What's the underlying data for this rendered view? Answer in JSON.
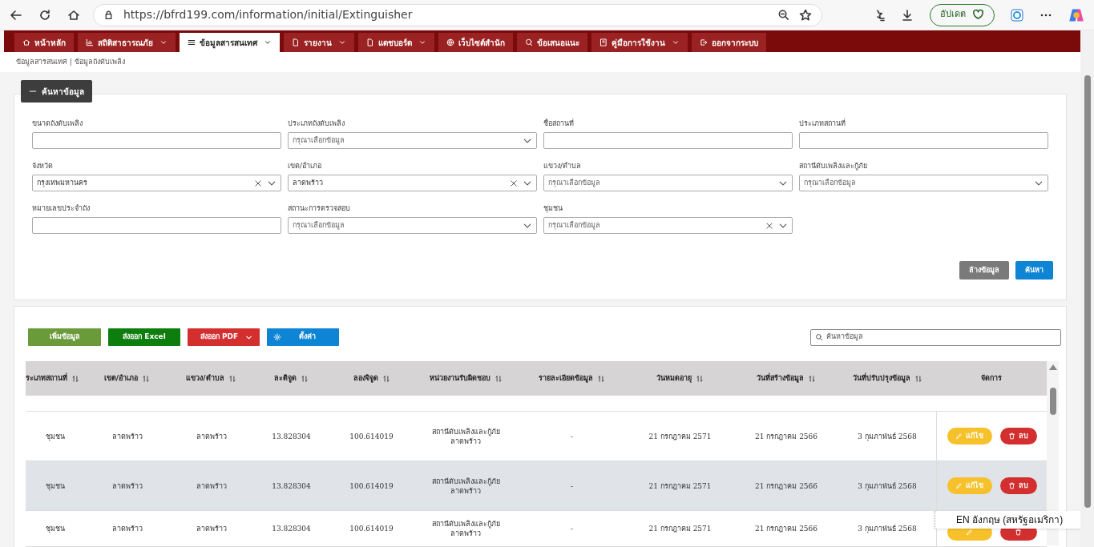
{
  "browser": {
    "url": "https://bfrd199.com/information/initial/Extinguisher",
    "update_button": "อัปเดต"
  },
  "nav": [
    {
      "label": "หน้าหลัก",
      "dropdown": false,
      "selected": false
    },
    {
      "label": "สถิติสาธารณภัย",
      "dropdown": true,
      "selected": false
    },
    {
      "label": "ข้อมูลสารสนเทศ",
      "dropdown": true,
      "selected": true
    },
    {
      "label": "รายงาน",
      "dropdown": true,
      "selected": false
    },
    {
      "label": "แดชบอร์ด",
      "dropdown": true,
      "selected": false
    },
    {
      "label": "เว็บไซต์สำนัก",
      "dropdown": false,
      "selected": false
    },
    {
      "label": "ข้อเสนอแนะ",
      "dropdown": false,
      "selected": false
    },
    {
      "label": "คู่มือการใช้งาน",
      "dropdown": true,
      "selected": false
    },
    {
      "label": "ออกจากระบบ",
      "dropdown": false,
      "selected": false
    }
  ],
  "breadcrumb": "ข้อมูลสารสนเทศ | ข้อมูลถังดับเพลิง",
  "search_panel": {
    "toggle": "ค้นหาข้อมูล",
    "expanded": true,
    "fields": [
      {
        "label": "ขนาดถังดับเพลิง",
        "kind": "text"
      },
      {
        "label": "ประเภทถังดับเพลิง",
        "kind": "select",
        "placeholder": "กรุณาเลือกข้อมูล",
        "clearable": false
      },
      {
        "label": "ชื่อสถานที่",
        "kind": "text"
      },
      {
        "label": "ประเภทสถานที่",
        "kind": "text"
      },
      {
        "label": "จังหวัด",
        "kind": "select",
        "value": "กรุงเทพมหานคร",
        "clearable": true
      },
      {
        "label": "เขต/อำเภอ",
        "kind": "select",
        "value": "ลาดพร้าว",
        "clearable": true
      },
      {
        "label": "แขวง/ตำบล",
        "kind": "select",
        "placeholder": "กรุณาเลือกข้อมูล",
        "clearable": false
      },
      {
        "label": "สถานีดับเพลิงและกู้ภัย",
        "kind": "select",
        "placeholder": "กรุณาเลือกข้อมูล",
        "clearable": false
      },
      {
        "label": "หมายเลขประจำถัง",
        "kind": "text"
      },
      {
        "label": "สถานะการตรวจสอบ",
        "kind": "select",
        "placeholder": "กรุณาเลือกข้อมูล",
        "clearable": false
      },
      {
        "label": "ชุมชน",
        "kind": "select",
        "placeholder": "กรุณาเลือกข้อมูล",
        "clearable": true
      }
    ],
    "clear_button": "ล้างข้อมูล",
    "search_button": "ค้นหา"
  },
  "toolbar": {
    "buttons": [
      {
        "label": "เพิ่มข้อมูล",
        "kind": "add"
      },
      {
        "label": "ส่งออก Excel",
        "kind": "excel"
      },
      {
        "label": "ส่งออก PDF",
        "kind": "pdf"
      },
      {
        "label": "ตั้งค่า",
        "kind": "settings"
      }
    ],
    "search_placeholder": "ค้นหาข้อมูล"
  },
  "table": {
    "columns": [
      "ระเภทสถานที่",
      "เขต/อำเภอ",
      "แขวง/ตำบล",
      "ละติจูด",
      "ลองจิจูด",
      "หน่วยงานรับผิดชอบ",
      "รายละเอียดข้อมูล",
      "วันหมดอายุ",
      "วันที่สร้างข้อมูล",
      "วันที่ปรับปรุงข้อมูล",
      "จัดการ"
    ],
    "rows": [
      {
        "cells": [
          "ชุมชน",
          "ลาดพร้าว",
          "ลาดพร้าว",
          "13.828304",
          "100.614019",
          "สถานีดับเพลิงและกู้ภัย ลาดพร้าว",
          "-",
          "21 กรกฎาคม 2571",
          "21 กรกฎาคม 2566",
          "3 กุมภาพันธ์ 2568"
        ],
        "edit": "แก้ไข",
        "delete": "ลบ",
        "highlighted": false
      },
      {
        "cells": [
          "ชุมชน",
          "ลาดพร้าว",
          "ลาดพร้าว",
          "13.828304",
          "100.614019",
          "สถานีดับเพลิงและกู้ภัย ลาดพร้าว",
          "-",
          "21 กรกฎาคม 2571",
          "21 กรกฎาคม 2566",
          "3 กุมภาพันธ์ 2568"
        ],
        "edit": "แก้ไข",
        "delete": "ลบ",
        "highlighted": true
      },
      {
        "cells": [
          "ชุมชน",
          "ลาดพร้าว",
          "ลาดพร้าว",
          "13.828304",
          "100.614019",
          "สถานีดับเพลิงและกู้ภัย ลาดพร้าว",
          "-",
          "21 กรกฎาคม 2571",
          "21 กรกฎาคม 2566",
          "3 กุมภาพันธ์ 2568"
        ],
        "highlighted": false
      }
    ]
  },
  "ime_popup": "EN อังกฤษ (สหรัฐอเมริกา)"
}
